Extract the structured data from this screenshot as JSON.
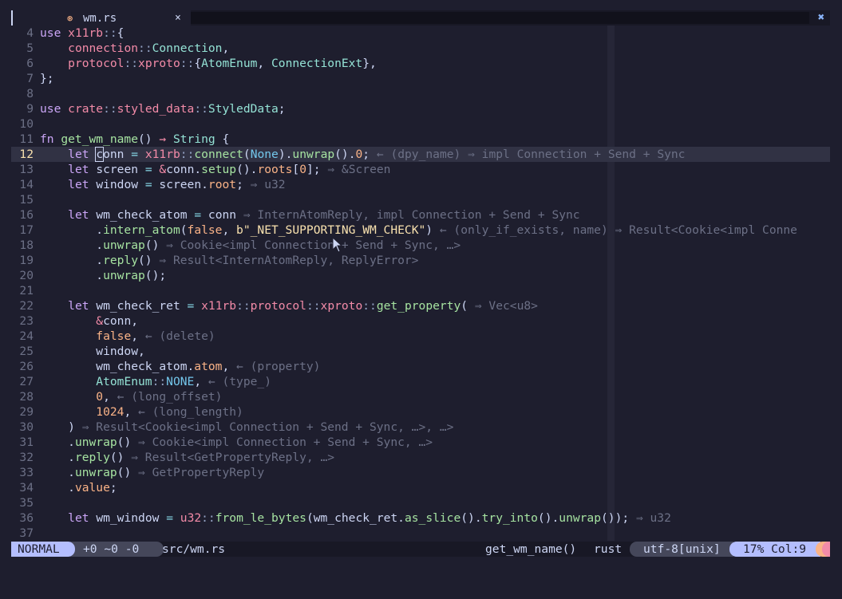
{
  "tab": {
    "icon": "rust-icon",
    "name": "wm.rs",
    "close": "×"
  },
  "tabline_close": "✖",
  "lines": [
    {
      "n": "4",
      "cur": false,
      "t": [
        [
          "kw",
          "use "
        ],
        [
          "md",
          "x11rb"
        ],
        [
          "pu",
          "::"
        ],
        [
          "pl",
          "{"
        ]
      ]
    },
    {
      "n": "5",
      "cur": false,
      "t": [
        [
          "pl",
          "    "
        ],
        [
          "md",
          "connection"
        ],
        [
          "pu",
          "::"
        ],
        [
          "ty",
          "Connection"
        ],
        [
          "pl",
          ","
        ]
      ]
    },
    {
      "n": "6",
      "cur": false,
      "t": [
        [
          "pl",
          "    "
        ],
        [
          "md",
          "protocol"
        ],
        [
          "pu",
          "::"
        ],
        [
          "md",
          "xproto"
        ],
        [
          "pu",
          "::"
        ],
        [
          "pl",
          "{"
        ],
        [
          "ty",
          "AtomEnum"
        ],
        [
          "pl",
          ", "
        ],
        [
          "ty",
          "ConnectionExt"
        ],
        [
          "pl",
          "},"
        ]
      ]
    },
    {
      "n": "7",
      "cur": false,
      "t": [
        [
          "pl",
          "};"
        ]
      ]
    },
    {
      "n": "8",
      "cur": false,
      "t": []
    },
    {
      "n": "9",
      "cur": false,
      "t": [
        [
          "kw",
          "use "
        ],
        [
          "md",
          "crate"
        ],
        [
          "pu",
          "::"
        ],
        [
          "md",
          "styled_data"
        ],
        [
          "pu",
          "::"
        ],
        [
          "ty",
          "StyledData"
        ],
        [
          "pl",
          ";"
        ]
      ]
    },
    {
      "n": "10",
      "cur": false,
      "t": []
    },
    {
      "n": "11",
      "cur": false,
      "t": [
        [
          "kw",
          "fn "
        ],
        [
          "fn",
          "get_wm_name"
        ],
        [
          "pl",
          "() "
        ],
        [
          "md",
          "→"
        ],
        [
          "pl",
          " "
        ],
        [
          "ty",
          "String"
        ],
        [
          "pl",
          " {"
        ]
      ]
    },
    {
      "n": "12",
      "cur": true,
      "t": [
        [
          "pl",
          "    "
        ],
        [
          "kw",
          "let "
        ],
        [
          "bc",
          "c"
        ],
        [
          "pl",
          "onn "
        ],
        [
          "op",
          "="
        ],
        [
          "pl",
          " "
        ],
        [
          "md",
          "x11rb"
        ],
        [
          "pu",
          "::"
        ],
        [
          "fn",
          "connect"
        ],
        [
          "pl",
          "("
        ],
        [
          "en",
          "None"
        ],
        [
          "pl",
          ")."
        ],
        [
          "fn",
          "unwrap"
        ],
        [
          "pl",
          "()."
        ],
        [
          "nu",
          "0"
        ],
        [
          "pl",
          ";"
        ],
        [
          "hint",
          " ← (dpy_name) ⇒ impl Connection + Send + Sync"
        ]
      ]
    },
    {
      "n": "13",
      "cur": false,
      "t": [
        [
          "pl",
          "    "
        ],
        [
          "kw",
          "let "
        ],
        [
          "pl",
          "screen "
        ],
        [
          "op",
          "="
        ],
        [
          "pl",
          " "
        ],
        [
          "md",
          "&"
        ],
        [
          "pl",
          "conn."
        ],
        [
          "fn",
          "setup"
        ],
        [
          "pl",
          "()."
        ],
        [
          "fld",
          "roots"
        ],
        [
          "pl",
          "["
        ],
        [
          "nu",
          "0"
        ],
        [
          "pl",
          "];"
        ],
        [
          "hint",
          " ⇒ &Screen"
        ]
      ]
    },
    {
      "n": "14",
      "cur": false,
      "t": [
        [
          "pl",
          "    "
        ],
        [
          "kw",
          "let "
        ],
        [
          "pl",
          "window "
        ],
        [
          "op",
          "="
        ],
        [
          "pl",
          " screen."
        ],
        [
          "fld",
          "root"
        ],
        [
          "pl",
          ";"
        ],
        [
          "hint",
          " ⇒ u32"
        ]
      ]
    },
    {
      "n": "15",
      "cur": false,
      "t": []
    },
    {
      "n": "16",
      "cur": false,
      "t": [
        [
          "pl",
          "    "
        ],
        [
          "kw",
          "let "
        ],
        [
          "pl",
          "wm_check_atom "
        ],
        [
          "op",
          "="
        ],
        [
          "pl",
          " conn"
        ],
        [
          "hint",
          " ⇒ InternAtomReply, impl Connection + Send + Sync"
        ]
      ]
    },
    {
      "n": "17",
      "cur": false,
      "t": [
        [
          "pl",
          "        ."
        ],
        [
          "fn",
          "intern_atom"
        ],
        [
          "pl",
          "("
        ],
        [
          "nu",
          "false"
        ],
        [
          "pl",
          ", "
        ],
        [
          "st",
          "b\"_NET_SUPPORTING_WM_CHECK\""
        ],
        [
          "pl",
          ")"
        ],
        [
          "hint",
          " ← (only_if_exists, name) ⇒ Result<Cookie<impl Conne"
        ]
      ]
    },
    {
      "n": "18",
      "cur": false,
      "t": [
        [
          "pl",
          "        ."
        ],
        [
          "fn",
          "unwrap"
        ],
        [
          "pl",
          "()"
        ],
        [
          "hint",
          " ⇒ Cookie<impl Connection + Send + Sync, …>"
        ]
      ]
    },
    {
      "n": "19",
      "cur": false,
      "t": [
        [
          "pl",
          "        ."
        ],
        [
          "fn",
          "reply"
        ],
        [
          "pl",
          "()"
        ],
        [
          "hint",
          " ⇒ Result<InternAtomReply, ReplyError>"
        ]
      ]
    },
    {
      "n": "20",
      "cur": false,
      "t": [
        [
          "pl",
          "        ."
        ],
        [
          "fn",
          "unwrap"
        ],
        [
          "pl",
          "();"
        ]
      ]
    },
    {
      "n": "21",
      "cur": false,
      "t": []
    },
    {
      "n": "22",
      "cur": false,
      "t": [
        [
          "pl",
          "    "
        ],
        [
          "kw",
          "let "
        ],
        [
          "pl",
          "wm_check_ret "
        ],
        [
          "op",
          "="
        ],
        [
          "pl",
          " "
        ],
        [
          "md",
          "x11rb"
        ],
        [
          "pu",
          "::"
        ],
        [
          "md",
          "protocol"
        ],
        [
          "pu",
          "::"
        ],
        [
          "md",
          "xproto"
        ],
        [
          "pu",
          "::"
        ],
        [
          "fn",
          "get_property"
        ],
        [
          "pl",
          "("
        ],
        [
          "hint",
          " ⇒ Vec<u8>"
        ]
      ]
    },
    {
      "n": "23",
      "cur": false,
      "t": [
        [
          "pl",
          "        "
        ],
        [
          "md",
          "&"
        ],
        [
          "pl",
          "conn,"
        ]
      ]
    },
    {
      "n": "24",
      "cur": false,
      "t": [
        [
          "pl",
          "        "
        ],
        [
          "nu",
          "false"
        ],
        [
          "pl",
          ","
        ],
        [
          "hint",
          " ← (delete)"
        ]
      ]
    },
    {
      "n": "25",
      "cur": false,
      "t": [
        [
          "pl",
          "        window,"
        ]
      ]
    },
    {
      "n": "26",
      "cur": false,
      "t": [
        [
          "pl",
          "        wm_check_atom."
        ],
        [
          "fld",
          "atom"
        ],
        [
          "pl",
          ","
        ],
        [
          "hint",
          " ← (property)"
        ]
      ]
    },
    {
      "n": "27",
      "cur": false,
      "t": [
        [
          "pl",
          "        "
        ],
        [
          "ty",
          "AtomEnum"
        ],
        [
          "pu",
          "::"
        ],
        [
          "en",
          "NONE"
        ],
        [
          "pl",
          ","
        ],
        [
          "hint",
          " ← (type_)"
        ]
      ]
    },
    {
      "n": "28",
      "cur": false,
      "t": [
        [
          "pl",
          "        "
        ],
        [
          "nu",
          "0"
        ],
        [
          "pl",
          ","
        ],
        [
          "hint",
          " ← (long_offset)"
        ]
      ]
    },
    {
      "n": "29",
      "cur": false,
      "t": [
        [
          "pl",
          "        "
        ],
        [
          "nu",
          "1024"
        ],
        [
          "pl",
          ","
        ],
        [
          "hint",
          " ← (long_length)"
        ]
      ]
    },
    {
      "n": "30",
      "cur": false,
      "t": [
        [
          "pl",
          "    )"
        ],
        [
          "hint",
          " ⇒ Result<Cookie<impl Connection + Send + Sync, …>, …>"
        ]
      ]
    },
    {
      "n": "31",
      "cur": false,
      "t": [
        [
          "pl",
          "    ."
        ],
        [
          "fn",
          "unwrap"
        ],
        [
          "pl",
          "()"
        ],
        [
          "hint",
          " ⇒ Cookie<impl Connection + Send + Sync, …>"
        ]
      ]
    },
    {
      "n": "32",
      "cur": false,
      "t": [
        [
          "pl",
          "    ."
        ],
        [
          "fn",
          "reply"
        ],
        [
          "pl",
          "()"
        ],
        [
          "hint",
          " ⇒ Result<GetPropertyReply, …>"
        ]
      ]
    },
    {
      "n": "33",
      "cur": false,
      "t": [
        [
          "pl",
          "    ."
        ],
        [
          "fn",
          "unwrap"
        ],
        [
          "pl",
          "()"
        ],
        [
          "hint",
          " ⇒ GetPropertyReply"
        ]
      ]
    },
    {
      "n": "34",
      "cur": false,
      "t": [
        [
          "pl",
          "    ."
        ],
        [
          "fld",
          "value"
        ],
        [
          "pl",
          ";"
        ]
      ]
    },
    {
      "n": "35",
      "cur": false,
      "t": []
    },
    {
      "n": "36",
      "cur": false,
      "t": [
        [
          "pl",
          "    "
        ],
        [
          "kw",
          "let "
        ],
        [
          "pl",
          "wm_window "
        ],
        [
          "op",
          "="
        ],
        [
          "pl",
          " "
        ],
        [
          "md",
          "u32"
        ],
        [
          "pu",
          "::"
        ],
        [
          "fn",
          "from_le_bytes"
        ],
        [
          "pl",
          "(wm_check_ret."
        ],
        [
          "fn",
          "as_slice"
        ],
        [
          "pl",
          "()."
        ],
        [
          "fn",
          "try_into"
        ],
        [
          "pl",
          "()."
        ],
        [
          "fn",
          "unwrap"
        ],
        [
          "pl",
          "());"
        ],
        [
          "hint",
          " ⇒ u32"
        ]
      ]
    },
    {
      "n": "37",
      "cur": false,
      "t": []
    }
  ],
  "status": {
    "mode": "NORMAL",
    "diff": "+0 ~0 -0",
    "file": "src/wm.rs",
    "function": "get_wm_name()",
    "filetype": "rust",
    "encoding": "utf-8[unix]",
    "position": "17% Col:9"
  },
  "colors": {
    "background": "#1e1e2e",
    "accent": "#b4befe",
    "current_line": "#313244"
  }
}
